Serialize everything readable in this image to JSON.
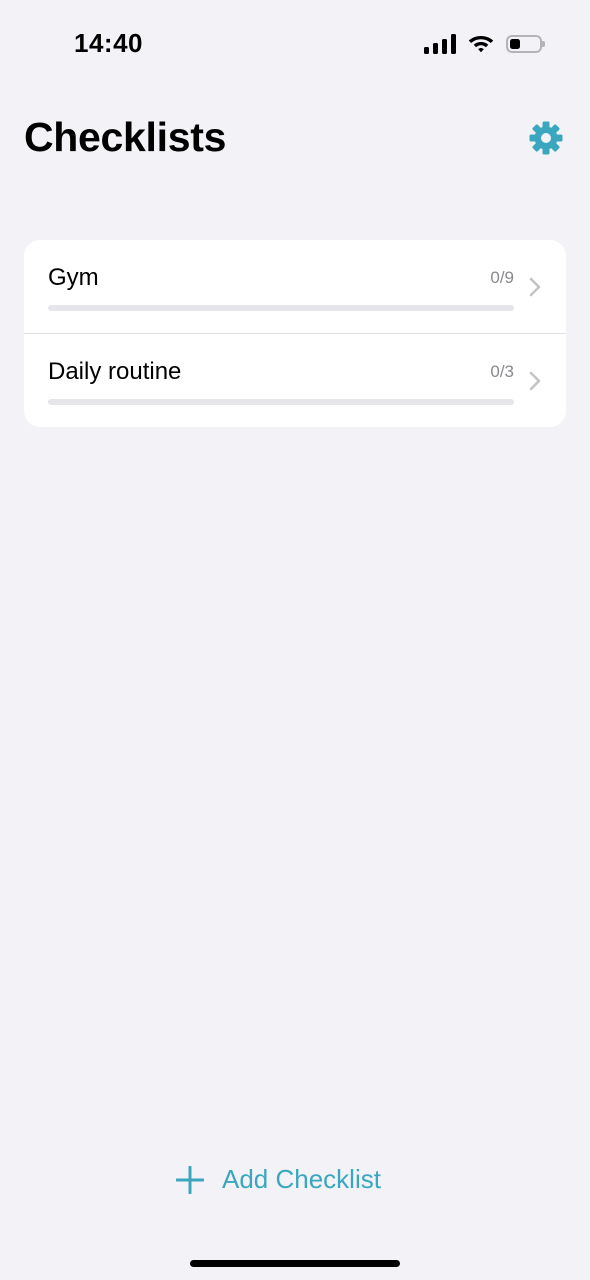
{
  "status_bar": {
    "time": "14:40",
    "battery_level": 0.35,
    "icons": [
      "cellular-signal-icon",
      "wifi-icon",
      "battery-icon"
    ]
  },
  "header": {
    "title": "Checklists",
    "settings_icon": "gear-icon"
  },
  "checklists": [
    {
      "title": "Gym",
      "count": "0/9",
      "progress": 0
    },
    {
      "title": "Daily routine",
      "count": "0/3",
      "progress": 0
    }
  ],
  "footer": {
    "add_label": "Add Checklist",
    "add_icon": "plus-icon"
  },
  "colors": {
    "accent": "#3aa7bf",
    "background": "#f2f2f7",
    "card": "#ffffff",
    "secondary_text": "#8a8a8e",
    "progress_track": "#e5e5ea"
  }
}
